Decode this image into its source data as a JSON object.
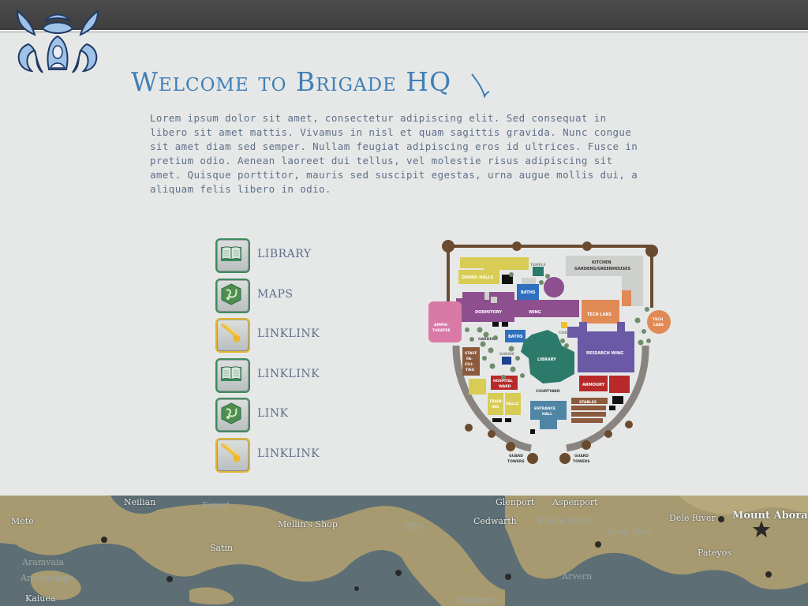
{
  "page": {
    "title": "Welcome to Brigade HQ"
  },
  "intro": {
    "lines": [
      "Lorem ipsum dolor sit amet, consectetur adipiscing elit. Sed consequat in",
      "libero sit amet mattis. Vivamus in nisl et quam sagittis gravida. Nunc congue",
      "sit amet diam sed semper. Nullam feugiat adipiscing eros id ultrices. Fusce in",
      "pretium odio. Aenean laoreet dui tellus, vel molestie risus adipiscing sit",
      "amet. Quisque porttitor, mauris sed suscipit egestas, urna augue mollis dui, a",
      "aliquam felis libero in odio."
    ]
  },
  "nav": {
    "items": [
      {
        "label": "LIBRARY",
        "icon": "book-icon",
        "frame": "green"
      },
      {
        "label": "MAPS",
        "icon": "map-icon",
        "frame": "green"
      },
      {
        "label": "LINKLINK",
        "icon": "comet-icon",
        "frame": "gold"
      },
      {
        "label": "LINKLINK",
        "icon": "book-icon",
        "frame": "green"
      },
      {
        "label": "LINK",
        "icon": "map-icon",
        "frame": "green"
      },
      {
        "label": "LINKLINK",
        "icon": "comet-icon",
        "frame": "gold"
      }
    ]
  },
  "hq_map": {
    "rooms": {
      "dining_halls": "DINING HALLS",
      "temple": "TEMPLE",
      "kitchen": "KITCHEN",
      "gardens_greenhouses": "GARDENS/GREENHOUSES",
      "baths_top": "BATHS",
      "dormitory": "DORMITORY",
      "wing": "WING",
      "tech_labs": "TECH LABS",
      "tech_labs_round_1": "TECH",
      "tech_labs_round_2": "LABS",
      "amphitheatre_1": "AMPHI-",
      "amphitheatre_2": "THEATRE",
      "gardens": "GARDENS",
      "baths": "BATHS",
      "chapel": "CHAPEL",
      "shrine": "SHRINE",
      "library": "LIBRARY",
      "research_wing": "RESEARCH WING",
      "staff_1": "STAFF",
      "staff_2": "FA-",
      "staff_3": "CILI-",
      "staff_4": "TIES",
      "hospital_1": "HOSPITAL",
      "hospital_2": "WARD",
      "armoury": "ARMOURY",
      "courtyard": "COURTYARD",
      "stables": "STABLES",
      "training_1": "TRAIN-",
      "training_2": "ING",
      "halls": "HALLS",
      "entrance_1": "ENTRANCE",
      "entrance_2": "HALL",
      "guard_towers_1": "GUARD",
      "guard_towers_2": "TOWERS"
    },
    "colors": {
      "wall": "#6b4b2f",
      "yellow": "#d8cc55",
      "purple": "#8e4f8f",
      "pink": "#d97aa6",
      "blue": "#2f6fbf",
      "teal": "#2c7a6a",
      "orange": "#e08a55",
      "research": "#6a5aa6",
      "red": "#b82a2a",
      "brown": "#8c5a3c",
      "steel": "#4f86a6",
      "stone": "#7a7470",
      "grey": "#cdd0cc"
    }
  },
  "world_map": {
    "places": [
      "Neilian",
      "Forest",
      "Mellin's Shop",
      "Mete",
      "Satin",
      "Kaiuea",
      "Glenport",
      "Aspenport",
      "Cedwarth",
      "Ericle River",
      "Ossa Pass",
      "Efris",
      "Mount Abora",
      "Dele River",
      "Pateyos",
      "Arvern",
      "Rinlasecn",
      "Aramvaia",
      "Archipelago"
    ]
  }
}
